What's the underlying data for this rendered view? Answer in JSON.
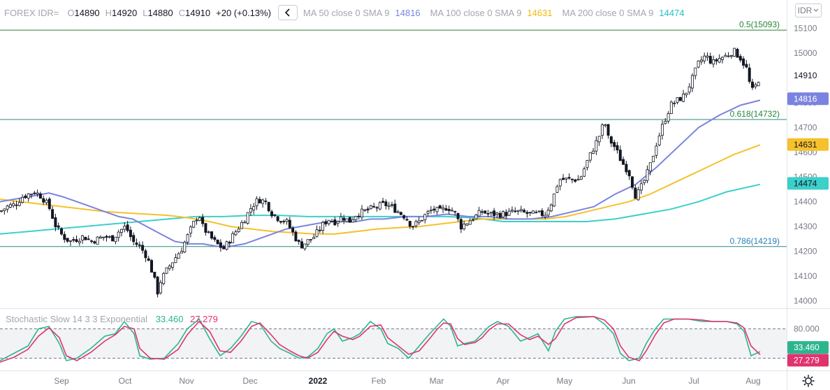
{
  "legend": {
    "symbol": "FOREX IDR=",
    "o_label": "O",
    "o_value": "14890",
    "h_label": "H",
    "h_value": "14920",
    "l_label": "L",
    "l_value": "14880",
    "c_label": "C",
    "c_value": "14910",
    "change": "+20 (+0.13%)",
    "ma50_label": "MA 50 close 0 SMA 9",
    "ma50_value": "14816",
    "ma100_label": "MA 100 close 0 SMA 9",
    "ma100_value": "14631",
    "ma200_label": "MA 200 close 0 SMA 9",
    "ma200_value": "14474"
  },
  "currency_select": "IDR",
  "stochastic": {
    "label": "Stochastic Slow 14 3 3 Exponential",
    "k_value": "33.460",
    "d_value": "27.279"
  },
  "colors": {
    "ma50": "#7b83e0",
    "ma100": "#f5c12c",
    "ma200": "#3dcfc9",
    "stoch_k": "#2bb58f",
    "stoch_d": "#e0336e",
    "fib_green": "#26843b",
    "fib_blue": "#2a7fb8"
  },
  "chart_data": {
    "type": "candlestick",
    "period": "daily",
    "ylim": [
      13970,
      15130
    ],
    "y_ticks": [
      "15100",
      "15000",
      "14900",
      "14800",
      "14700",
      "14600",
      "14500",
      "14400",
      "14300",
      "14200",
      "14100",
      "14000"
    ],
    "x_ticks": [
      "Sep",
      "Oct",
      "Nov",
      "Dec",
      "2022",
      "Feb",
      "Mar",
      "Apr",
      "May",
      "Jun",
      "Jul",
      "Aug"
    ],
    "last_price": 14910,
    "ohlc_last": {
      "open": 14890,
      "high": 14920,
      "low": 14880,
      "close": 14910
    },
    "close_path": [
      [
        0,
        14360
      ],
      [
        10,
        14380
      ],
      [
        22,
        14390
      ],
      [
        32,
        14420
      ],
      [
        40,
        14430
      ],
      [
        50,
        14440
      ],
      [
        60,
        14420
      ],
      [
        70,
        14380
      ],
      [
        80,
        14300
      ],
      [
        90,
        14260
      ],
      [
        100,
        14240
      ],
      [
        110,
        14250
      ],
      [
        120,
        14260
      ],
      [
        130,
        14240
      ],
      [
        140,
        14250
      ],
      [
        150,
        14260
      ],
      [
        160,
        14250
      ],
      [
        170,
        14280
      ],
      [
        180,
        14300
      ],
      [
        190,
        14240
      ],
      [
        200,
        14220
      ],
      [
        210,
        14180
      ],
      [
        220,
        14100
      ],
      [
        225,
        14030
      ],
      [
        230,
        14080
      ],
      [
        240,
        14130
      ],
      [
        250,
        14170
      ],
      [
        260,
        14210
      ],
      [
        270,
        14270
      ],
      [
        280,
        14330
      ],
      [
        285,
        14350
      ],
      [
        290,
        14300
      ],
      [
        300,
        14260
      ],
      [
        310,
        14230
      ],
      [
        320,
        14210
      ],
      [
        330,
        14250
      ],
      [
        340,
        14290
      ],
      [
        350,
        14330
      ],
      [
        360,
        14380
      ],
      [
        370,
        14410
      ],
      [
        380,
        14400
      ],
      [
        390,
        14350
      ],
      [
        400,
        14330
      ],
      [
        410,
        14320
      ],
      [
        420,
        14270
      ],
      [
        430,
        14220
      ],
      [
        440,
        14240
      ],
      [
        450,
        14260
      ],
      [
        460,
        14300
      ],
      [
        470,
        14330
      ],
      [
        480,
        14320
      ],
      [
        490,
        14340
      ],
      [
        500,
        14320
      ],
      [
        510,
        14350
      ],
      [
        520,
        14360
      ],
      [
        530,
        14370
      ],
      [
        540,
        14380
      ],
      [
        550,
        14390
      ],
      [
        560,
        14380
      ],
      [
        570,
        14360
      ],
      [
        580,
        14340
      ],
      [
        590,
        14300
      ],
      [
        600,
        14320
      ],
      [
        610,
        14350
      ],
      [
        620,
        14370
      ],
      [
        630,
        14360
      ],
      [
        640,
        14380
      ],
      [
        650,
        14360
      ],
      [
        660,
        14300
      ],
      [
        670,
        14320
      ],
      [
        680,
        14340
      ],
      [
        690,
        14360
      ],
      [
        700,
        14350
      ],
      [
        720,
        14350
      ],
      [
        740,
        14360
      ],
      [
        760,
        14350
      ],
      [
        780,
        14350
      ],
      [
        790,
        14400
      ],
      [
        800,
        14490
      ],
      [
        810,
        14490
      ],
      [
        830,
        14490
      ],
      [
        840,
        14560
      ],
      [
        850,
        14620
      ],
      [
        860,
        14680
      ],
      [
        865,
        14730
      ],
      [
        870,
        14660
      ],
      [
        880,
        14620
      ],
      [
        890,
        14560
      ],
      [
        900,
        14520
      ],
      [
        905,
        14470
      ],
      [
        910,
        14420
      ],
      [
        920,
        14470
      ],
      [
        930,
        14540
      ],
      [
        940,
        14640
      ],
      [
        950,
        14720
      ],
      [
        960,
        14790
      ],
      [
        970,
        14810
      ],
      [
        980,
        14830
      ],
      [
        990,
        14890
      ],
      [
        1000,
        14960
      ],
      [
        1010,
        14990
      ],
      [
        1020,
        14960
      ],
      [
        1030,
        14980
      ],
      [
        1040,
        14990
      ],
      [
        1050,
        15010
      ],
      [
        1060,
        14980
      ],
      [
        1070,
        14930
      ],
      [
        1075,
        14840
      ],
      [
        1082,
        14870
      ],
      [
        1088,
        14910
      ]
    ],
    "moving_averages": [
      {
        "name": "MA 50 close 0 SMA 9",
        "last": 14816
      },
      {
        "name": "MA 100 close 0 SMA 9",
        "last": 14631
      },
      {
        "name": "MA 200 close 0 SMA 9",
        "last": 14474
      }
    ],
    "ma50_path": [
      [
        0,
        14400
      ],
      [
        20,
        14410
      ],
      [
        40,
        14420
      ],
      [
        60,
        14430
      ],
      [
        70,
        14435
      ],
      [
        90,
        14420
      ],
      [
        110,
        14400
      ],
      [
        130,
        14380
      ],
      [
        150,
        14360
      ],
      [
        170,
        14340
      ],
      [
        190,
        14330
      ],
      [
        210,
        14300
      ],
      [
        230,
        14270
      ],
      [
        250,
        14240
      ],
      [
        270,
        14230
      ],
      [
        290,
        14230
      ],
      [
        310,
        14220
      ],
      [
        330,
        14220
      ],
      [
        350,
        14230
      ],
      [
        370,
        14250
      ],
      [
        390,
        14270
      ],
      [
        410,
        14290
      ],
      [
        430,
        14300
      ],
      [
        450,
        14310
      ],
      [
        470,
        14320
      ],
      [
        490,
        14320
      ],
      [
        510,
        14320
      ],
      [
        530,
        14330
      ],
      [
        550,
        14330
      ],
      [
        580,
        14340
      ],
      [
        610,
        14340
      ],
      [
        640,
        14350
      ],
      [
        670,
        14340
      ],
      [
        700,
        14340
      ],
      [
        730,
        14330
      ],
      [
        760,
        14330
      ],
      [
        790,
        14340
      ],
      [
        820,
        14360
      ],
      [
        850,
        14380
      ],
      [
        880,
        14430
      ],
      [
        910,
        14470
      ],
      [
        940,
        14540
      ],
      [
        970,
        14620
      ],
      [
        1000,
        14700
      ],
      [
        1030,
        14750
      ],
      [
        1060,
        14790
      ],
      [
        1088,
        14810
      ]
    ],
    "ma100_path": [
      [
        0,
        14410
      ],
      [
        30,
        14400
      ],
      [
        60,
        14390
      ],
      [
        90,
        14380
      ],
      [
        120,
        14370
      ],
      [
        150,
        14360
      ],
      [
        180,
        14355
      ],
      [
        210,
        14350
      ],
      [
        240,
        14345
      ],
      [
        270,
        14335
      ],
      [
        300,
        14320
      ],
      [
        330,
        14300
      ],
      [
        360,
        14290
      ],
      [
        390,
        14280
      ],
      [
        420,
        14275
      ],
      [
        450,
        14270
      ],
      [
        480,
        14270
      ],
      [
        510,
        14280
      ],
      [
        540,
        14290
      ],
      [
        570,
        14295
      ],
      [
        600,
        14300
      ],
      [
        630,
        14310
      ],
      [
        660,
        14320
      ],
      [
        690,
        14330
      ],
      [
        720,
        14330
      ],
      [
        750,
        14330
      ],
      [
        780,
        14330
      ],
      [
        810,
        14340
      ],
      [
        840,
        14360
      ],
      [
        870,
        14380
      ],
      [
        900,
        14400
      ],
      [
        930,
        14430
      ],
      [
        960,
        14470
      ],
      [
        990,
        14510
      ],
      [
        1020,
        14550
      ],
      [
        1050,
        14590
      ],
      [
        1088,
        14630
      ]
    ],
    "ma200_path": [
      [
        0,
        14270
      ],
      [
        40,
        14280
      ],
      [
        80,
        14290
      ],
      [
        120,
        14300
      ],
      [
        160,
        14310
      ],
      [
        200,
        14320
      ],
      [
        240,
        14330
      ],
      [
        280,
        14340
      ],
      [
        320,
        14340
      ],
      [
        360,
        14345
      ],
      [
        400,
        14345
      ],
      [
        440,
        14340
      ],
      [
        480,
        14340
      ],
      [
        520,
        14340
      ],
      [
        560,
        14340
      ],
      [
        600,
        14340
      ],
      [
        640,
        14340
      ],
      [
        680,
        14335
      ],
      [
        720,
        14320
      ],
      [
        760,
        14320
      ],
      [
        800,
        14320
      ],
      [
        840,
        14320
      ],
      [
        880,
        14330
      ],
      [
        920,
        14350
      ],
      [
        960,
        14370
      ],
      [
        1000,
        14400
      ],
      [
        1040,
        14440
      ],
      [
        1088,
        14470
      ]
    ],
    "fib_levels": [
      {
        "label": "0.5(15093)",
        "value": 15093
      },
      {
        "label": "0.618(14732)",
        "value": 14732
      },
      {
        "label": "0.786(14219)",
        "value": 14219
      }
    ],
    "stochastic": {
      "name": "Stochastic Slow 14 3 3 Exponential",
      "levels": [
        80,
        20
      ],
      "level_label": "80.000",
      "last_k": 33.46,
      "last_d": 27.279,
      "k_path": [
        [
          0,
          15
        ],
        [
          20,
          30
        ],
        [
          40,
          45
        ],
        [
          55,
          80
        ],
        [
          70,
          85
        ],
        [
          85,
          50
        ],
        [
          95,
          15
        ],
        [
          110,
          20
        ],
        [
          130,
          40
        ],
        [
          150,
          65
        ],
        [
          165,
          70
        ],
        [
          178,
          95
        ],
        [
          192,
          70
        ],
        [
          200,
          25
        ],
        [
          215,
          18
        ],
        [
          235,
          20
        ],
        [
          255,
          50
        ],
        [
          268,
          80
        ],
        [
          285,
          100
        ],
        [
          300,
          60
        ],
        [
          315,
          25
        ],
        [
          330,
          40
        ],
        [
          345,
          65
        ],
        [
          360,
          95
        ],
        [
          372,
          90
        ],
        [
          388,
          55
        ],
        [
          400,
          40
        ],
        [
          415,
          30
        ],
        [
          428,
          20
        ],
        [
          440,
          22
        ],
        [
          455,
          40
        ],
        [
          468,
          70
        ],
        [
          478,
          80
        ],
        [
          490,
          55
        ],
        [
          505,
          62
        ],
        [
          515,
          70
        ],
        [
          530,
          95
        ],
        [
          545,
          80
        ],
        [
          555,
          50
        ],
        [
          570,
          40
        ],
        [
          585,
          20
        ],
        [
          600,
          45
        ],
        [
          615,
          70
        ],
        [
          625,
          85
        ],
        [
          635,
          100
        ],
        [
          645,
          85
        ],
        [
          655,
          45
        ],
        [
          665,
          50
        ],
        [
          680,
          55
        ],
        [
          690,
          70
        ],
        [
          700,
          85
        ],
        [
          712,
          95
        ],
        [
          728,
          85
        ],
        [
          745,
          55
        ],
        [
          758,
          62
        ],
        [
          770,
          70
        ],
        [
          785,
          35
        ],
        [
          795,
          75
        ],
        [
          808,
          100
        ],
        [
          825,
          105
        ],
        [
          850,
          105
        ],
        [
          865,
          90
        ],
        [
          878,
          70
        ],
        [
          888,
          30
        ],
        [
          900,
          15
        ],
        [
          915,
          20
        ],
        [
          925,
          50
        ],
        [
          938,
          80
        ],
        [
          950,
          100
        ],
        [
          965,
          100
        ],
        [
          985,
          100
        ],
        [
          1005,
          95
        ],
        [
          1020,
          95
        ],
        [
          1040,
          95
        ],
        [
          1055,
          90
        ],
        [
          1065,
          75
        ],
        [
          1075,
          25
        ],
        [
          1088,
          33.46
        ]
      ],
      "d_path": [
        [
          0,
          12
        ],
        [
          20,
          22
        ],
        [
          40,
          38
        ],
        [
          55,
          65
        ],
        [
          70,
          82
        ],
        [
          85,
          62
        ],
        [
          95,
          25
        ],
        [
          110,
          15
        ],
        [
          130,
          32
        ],
        [
          150,
          55
        ],
        [
          165,
          68
        ],
        [
          178,
          85
        ],
        [
          192,
          80
        ],
        [
          200,
          40
        ],
        [
          215,
          20
        ],
        [
          235,
          18
        ],
        [
          255,
          38
        ],
        [
          268,
          68
        ],
        [
          285,
          95
        ],
        [
          300,
          75
        ],
        [
          315,
          35
        ],
        [
          330,
          32
        ],
        [
          345,
          55
        ],
        [
          360,
          85
        ],
        [
          372,
          92
        ],
        [
          388,
          68
        ],
        [
          400,
          48
        ],
        [
          415,
          35
        ],
        [
          428,
          25
        ],
        [
          440,
          20
        ],
        [
          455,
          32
        ],
        [
          468,
          58
        ],
        [
          478,
          75
        ],
        [
          490,
          65
        ],
        [
          505,
          58
        ],
        [
          515,
          65
        ],
        [
          530,
          85
        ],
        [
          545,
          88
        ],
        [
          555,
          62
        ],
        [
          570,
          45
        ],
        [
          585,
          28
        ],
        [
          600,
          35
        ],
        [
          615,
          60
        ],
        [
          625,
          78
        ],
        [
          635,
          92
        ],
        [
          645,
          90
        ],
        [
          655,
          60
        ],
        [
          665,
          48
        ],
        [
          680,
          52
        ],
        [
          690,
          62
        ],
        [
          700,
          78
        ],
        [
          712,
          90
        ],
        [
          728,
          90
        ],
        [
          745,
          68
        ],
        [
          758,
          58
        ],
        [
          770,
          65
        ],
        [
          785,
          48
        ],
        [
          795,
          60
        ],
        [
          808,
          90
        ],
        [
          825,
          103
        ],
        [
          850,
          105
        ],
        [
          865,
          98
        ],
        [
          878,
          80
        ],
        [
          888,
          45
        ],
        [
          900,
          22
        ],
        [
          915,
          15
        ],
        [
          925,
          35
        ],
        [
          938,
          68
        ],
        [
          950,
          92
        ],
        [
          965,
          100
        ],
        [
          985,
          100
        ],
        [
          1005,
          98
        ],
        [
          1020,
          95
        ],
        [
          1040,
          95
        ],
        [
          1055,
          92
        ],
        [
          1065,
          82
        ],
        [
          1075,
          45
        ],
        [
          1088,
          27.279
        ]
      ]
    }
  }
}
